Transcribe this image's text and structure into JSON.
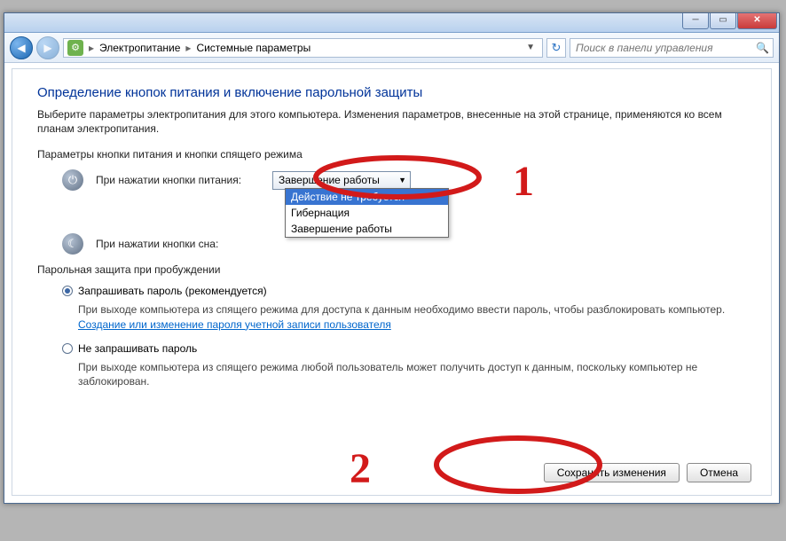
{
  "breadcrumb": {
    "item1": "Электропитание",
    "item2": "Системные параметры"
  },
  "search": {
    "placeholder": "Поиск в панели управления"
  },
  "page": {
    "title": "Определение кнопок питания и включение парольной защиты",
    "intro": "Выберите параметры электропитания для этого компьютера. Изменения параметров, внесенные на этой странице, применяются ко всем планам электропитания.",
    "section1_label": "Параметры кнопки питания и кнопки спящего режима",
    "power_button_label": "При нажатии кнопки питания:",
    "power_combo_value": "Завершение работы",
    "sleep_button_label": "При нажатии кнопки сна:",
    "dropdown": {
      "opt1": "Действие не требуется",
      "opt2": "Гибернация",
      "opt3": "Завершение работы"
    },
    "section2_label": "Парольная защита при пробуждении",
    "radio1_label": "Запрашивать пароль (рекомендуется)",
    "radio1_desc_a": "При выходе компьютера из спящего режима для доступа к данным необходимо ввести пароль, чтобы разблокировать компьютер. ",
    "radio1_link": "Создание или изменение пароля учетной записи пользователя",
    "radio2_label": "Не запрашивать пароль",
    "radio2_desc": "При выходе компьютера из спящего режима любой пользователь может получить доступ к данным, поскольку компьютер не заблокирован."
  },
  "footer": {
    "save": "Сохранить изменения",
    "cancel": "Отмена"
  },
  "annotations": {
    "n1": "1",
    "n2": "2"
  }
}
